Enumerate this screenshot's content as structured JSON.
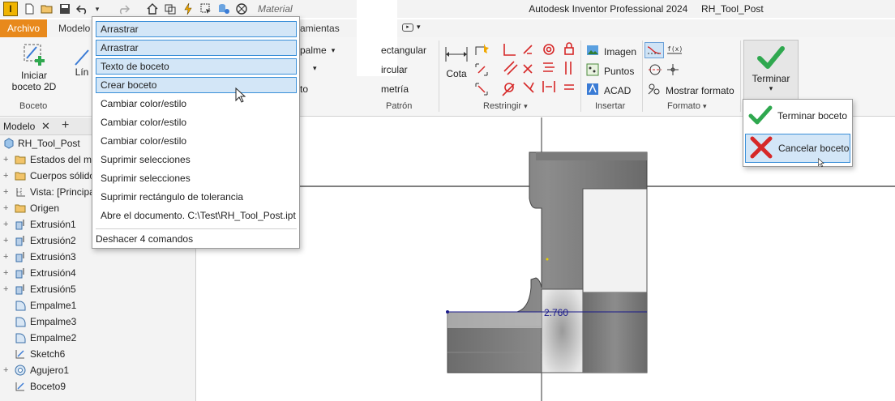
{
  "quick_access": {
    "logo_letter": "I",
    "material_label": "Material"
  },
  "title": {
    "app": "Autodesk Inventor Professional 2024",
    "document": "RH_Tool_Post"
  },
  "tabs": {
    "archivo": "Archivo",
    "modelo": "Modelo",
    "herramientas_partial": "ramientas"
  },
  "ribbon": {
    "boceto_panel": {
      "label": "Boceto",
      "iniciar_line1": "Iniciar",
      "iniciar_line2": "boceto 2D",
      "linea_partial": "Lín"
    },
    "crear_panel": {
      "empalme_partial": "palme",
      "texto_partial": "to"
    },
    "patron_panel": {
      "label": "Patrón",
      "rectangular": "ectangular",
      "circular": "ircular",
      "simetria": "metría"
    },
    "restringir_panel": {
      "label": "Restringir",
      "cota": "Cota"
    },
    "insertar_panel": {
      "label": "Insertar",
      "imagen": "Imagen",
      "puntos": "Puntos",
      "acad": "ACAD"
    },
    "formato_panel": {
      "label": "Formato",
      "mostrar_formato": "Mostrar formato"
    },
    "terminar_panel": {
      "terminar": "Terminar"
    }
  },
  "undo_menu": {
    "items": [
      "Arrastrar",
      "Arrastrar",
      "Texto de boceto",
      "Crear boceto",
      "Cambiar color/estilo",
      "Cambiar color/estilo",
      "Cambiar color/estilo",
      "Suprimir selecciones",
      "Suprimir selecciones",
      "Suprimir rectángulo de tolerancia",
      "Abre el documento. C:\\Test\\RH_Tool_Post.ipt"
    ],
    "footer": "Deshacer 4 comandos"
  },
  "browser": {
    "tab_label": "Modelo",
    "root": "RH_Tool_Post",
    "items": [
      "Estados del m",
      "Cuerpos sólido",
      "Vista: [Principa",
      "Origen",
      "Extrusión1",
      "Extrusión2",
      "Extrusión3",
      "Extrusión4",
      "Extrusión5",
      "Empalme1",
      "Empalme3",
      "Empalme2",
      "Sketch6",
      "Agujero1",
      "Boceto9"
    ]
  },
  "viewport": {
    "dimension": "2.760"
  },
  "finish_popup": {
    "terminar_boceto": "Terminar boceto",
    "cancelar_boceto": "Cancelar boceto"
  },
  "colors": {
    "accent_orange": "#e8891c",
    "highlight_fill": "#d3e6f7",
    "highlight_border": "#3a8fd8",
    "check_green": "#2fa84f",
    "cancel_red": "#d62828"
  }
}
